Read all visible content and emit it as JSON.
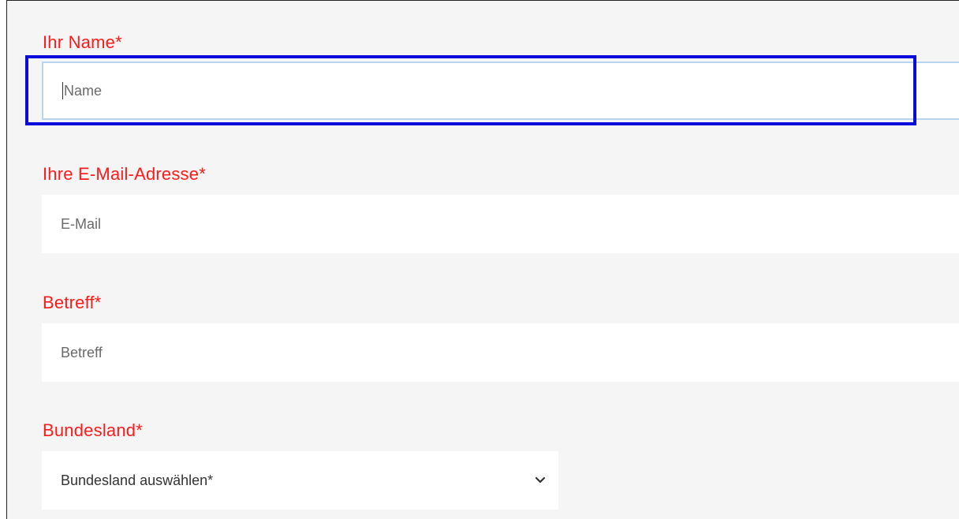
{
  "form": {
    "name": {
      "label": "Ihr Name*",
      "placeholder": "Name"
    },
    "email": {
      "label": "Ihre E-Mail-Adresse*",
      "placeholder": "E-Mail"
    },
    "subject": {
      "label": "Betreff*",
      "placeholder": "Betreff"
    },
    "state": {
      "label": "Bundesland*",
      "selected": "Bundesland auswählen*"
    }
  },
  "colors": {
    "label": "#ff1a1a",
    "highlight": "#0a0adc",
    "background": "#f5f5f5",
    "focus_border": "#b9d4ef"
  },
  "icons": {
    "select": "chevron-down-icon"
  }
}
